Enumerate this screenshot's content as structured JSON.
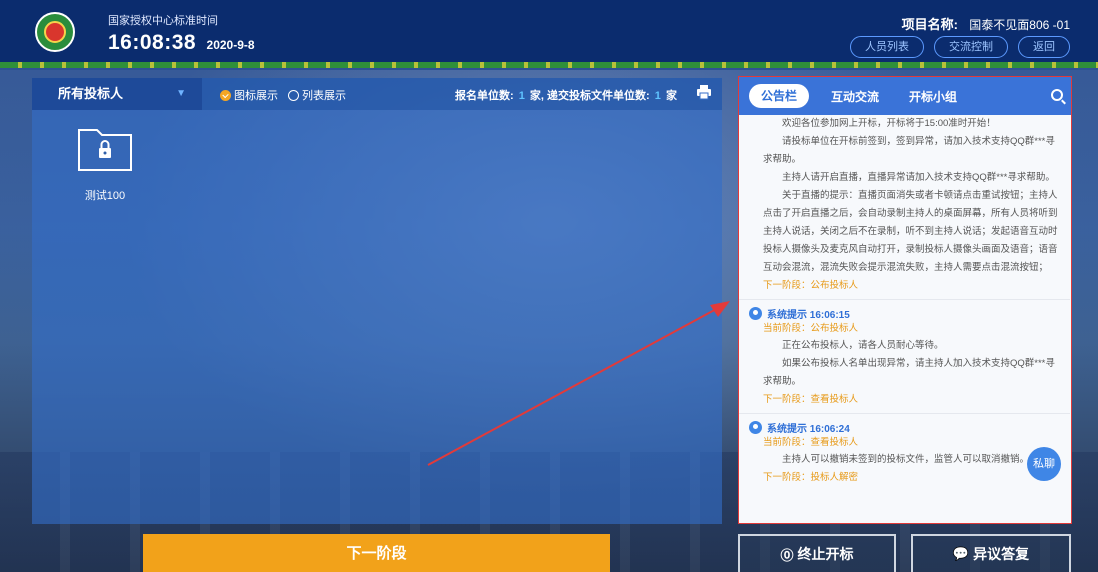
{
  "header": {
    "authority_label": "国家授权中心标准时间",
    "time": "16:08:38",
    "date": "2020-9-8",
    "project_key": "项目名称:",
    "project_value": "国泰不见面806 -01",
    "buttons": [
      "人员列表",
      "交流控制",
      "返回"
    ]
  },
  "left": {
    "bidder_select": "所有投标人",
    "view_icon": "图标展示",
    "view_list": "列表展示",
    "counts_prefix": "报名单位数:",
    "registered_count": "1",
    "counts_mid": "家, 递交投标文件单位数:",
    "submitted_count": "1",
    "counts_suffix": "家",
    "folder_name": "测试100"
  },
  "right": {
    "tabs": [
      "公告栏",
      "互动交流",
      "开标小组"
    ],
    "notice": [
      "欢迎各位参加网上开标，开标将于15:00准时开始！",
      "请投标单位在开标前签到，签到异常，请加入技术支持QQ群***寻求帮助。",
      "主持人请开启直播，直播异常请加入技术支持QQ群***寻求帮助。",
      "关于直播的提示：直播页面消失或者卡顿请点击重试按钮；主持人点击了开启直播之后，会自动录制主持人的桌面屏幕，所有人员将听到主持人说话，关闭之后不在录制，听不到主持人说话；发起语音互动时投标人摄像头及麦克风自动打开，录制投标人摄像头画面及语音；语音互动会混流，混流失败会提示混流失败，主持人需要点击混流按钮；"
    ],
    "notice_next": "下一阶段：公布投标人",
    "messages": [
      {
        "title": "系统提示 16:06:15",
        "current": "当前阶段：公布投标人",
        "lines": [
          "正在公布投标人，请各人员耐心等待。",
          "如果公布投标人名单出现异常，请主持人加入技术支持QQ群***寻求帮助。"
        ],
        "next": "下一阶段：查看投标人"
      },
      {
        "title": "系统提示 16:06:24",
        "current": "当前阶段：查看投标人",
        "lines": [
          "主持人可以撤销未签到的投标文件，监管人可以取消撤销。"
        ],
        "next": "下一阶段：投标人解密"
      }
    ],
    "private_chat": "私聊"
  },
  "footer": {
    "next_stage": "下一阶段",
    "stop": "终止开标",
    "objection": "异议答复"
  },
  "colors": {
    "header_bg": "#0b2c6e",
    "accent_orange": "#f2a21a",
    "accent_blue": "#3a73d8",
    "highlight_red": "#e23a3a"
  }
}
